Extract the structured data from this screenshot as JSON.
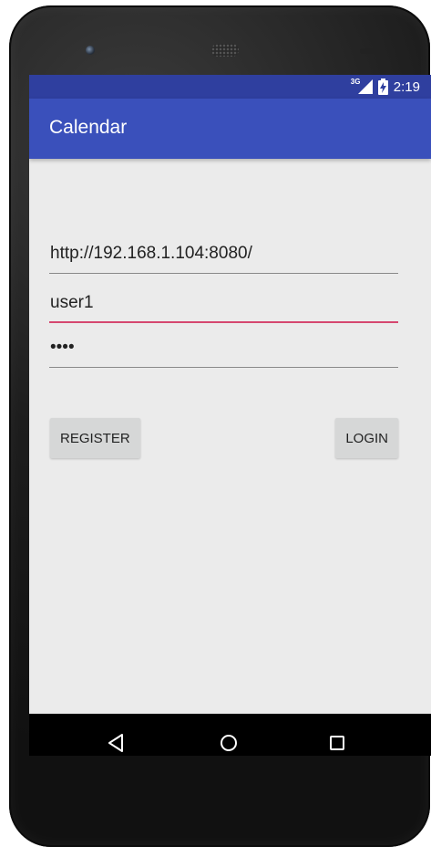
{
  "status_bar": {
    "network_type": "3G",
    "time": "2:19",
    "icons": [
      "signal-icon",
      "battery-icon"
    ]
  },
  "app_bar": {
    "title": "Calendar"
  },
  "form": {
    "server_url": {
      "value": "http://192.168.1.104:8080/"
    },
    "username": {
      "value": "user1"
    },
    "password": {
      "value": "••••"
    }
  },
  "buttons": {
    "register_label": "REGISTER",
    "login_label": "LOGIN"
  },
  "nav_bar": {
    "icons": [
      "back-icon",
      "home-icon",
      "recents-icon"
    ]
  },
  "colors": {
    "status_bar": "#2f3f9f",
    "app_bar": "#3a50bb",
    "accent": "#d5476f",
    "background": "#ebebeb"
  }
}
